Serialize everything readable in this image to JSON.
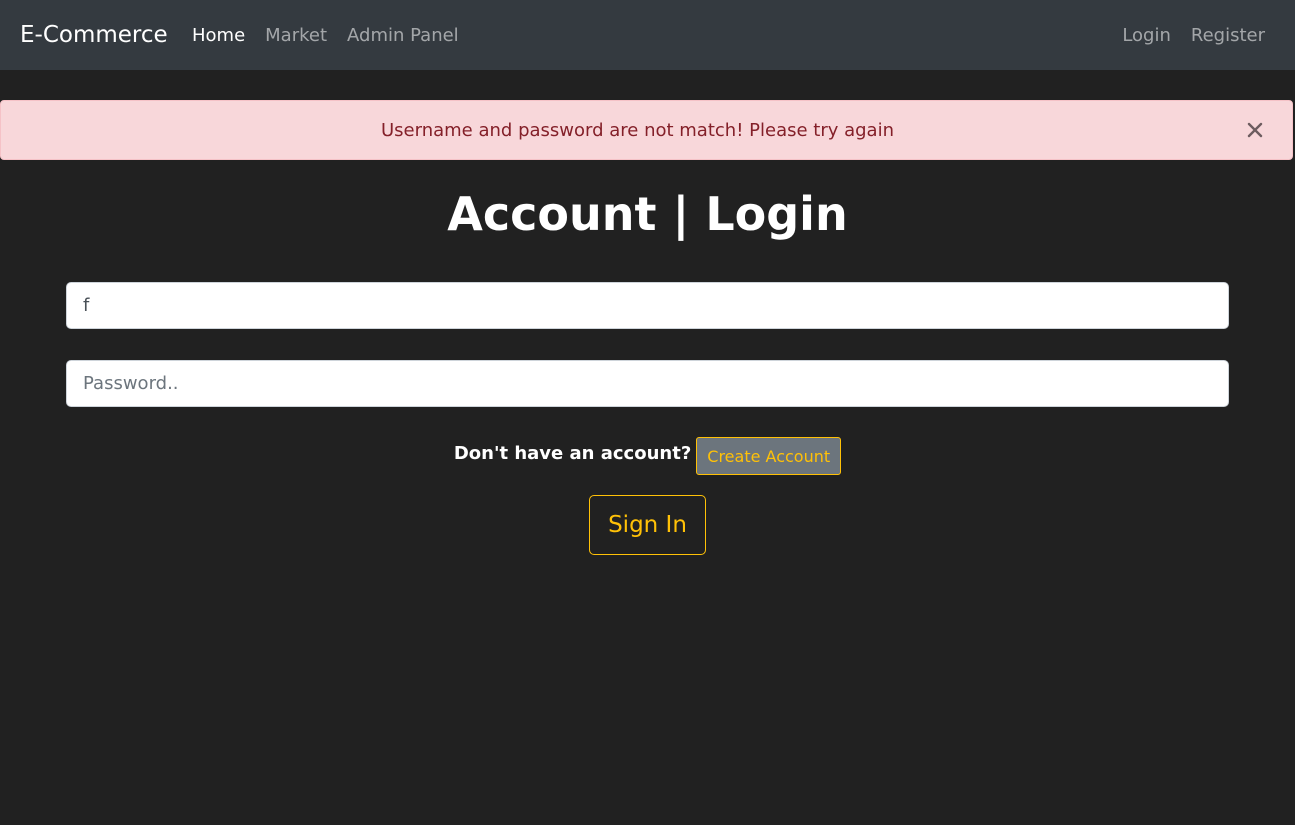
{
  "navbar": {
    "brand": "E-Commerce",
    "left_links": [
      {
        "label": "Home",
        "active": true
      },
      {
        "label": "Market",
        "active": false
      },
      {
        "label": "Admin Panel",
        "active": false
      }
    ],
    "right_links": [
      {
        "label": "Login"
      },
      {
        "label": "Register"
      }
    ]
  },
  "alert": {
    "message": "Username and password are not match! Please try again",
    "close_icon": "close-icon"
  },
  "page": {
    "title": "Account | Login"
  },
  "form": {
    "username_value": "f",
    "password_value": "",
    "password_placeholder": "Password..",
    "signup_prompt": "Don't have an account?",
    "create_account_label": "Create Account",
    "signin_label": "Sign In"
  },
  "colors": {
    "background": "#212121",
    "navbar": "#343a40",
    "accent": "#ffc107",
    "alert_bg": "#f8d7da",
    "alert_text": "#842029"
  }
}
